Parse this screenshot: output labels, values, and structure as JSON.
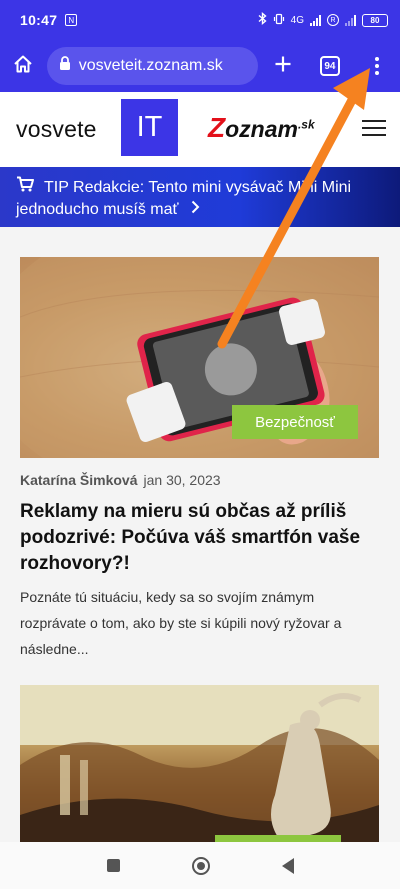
{
  "status_bar": {
    "time": "10:47",
    "battery": "80",
    "network": "4G"
  },
  "browser": {
    "url": "vosveteit.zoznam.sk",
    "tab_count": "94"
  },
  "site": {
    "logo_text": "vosvete",
    "logo_badge": "IT",
    "partner_logo": "oznam",
    "partner_logo_initial": "Z",
    "partner_logo_suffix": ".sk"
  },
  "promo": {
    "line1": "TIP Redakcie: Tento mini vysávač Mini Mini",
    "line2": "jednoducho musíš mať"
  },
  "articles": [
    {
      "category": "Bezpečnosť",
      "author": "Katarína Šimková",
      "date": "jan 30, 2023",
      "title": "Reklamy na mieru sú občas až príliš podozrivé: Počúva váš smartfón vaše rozhovory?!",
      "excerpt": "Poznáte tú situáciu, kedy sa so svojím známym rozprávate o tom, ako by ste si kúpili nový ryžovar a následne..."
    }
  ],
  "colors": {
    "brand_blue": "#3c35e6",
    "category_green": "#8dc63f",
    "arrow_orange": "#f58220"
  }
}
